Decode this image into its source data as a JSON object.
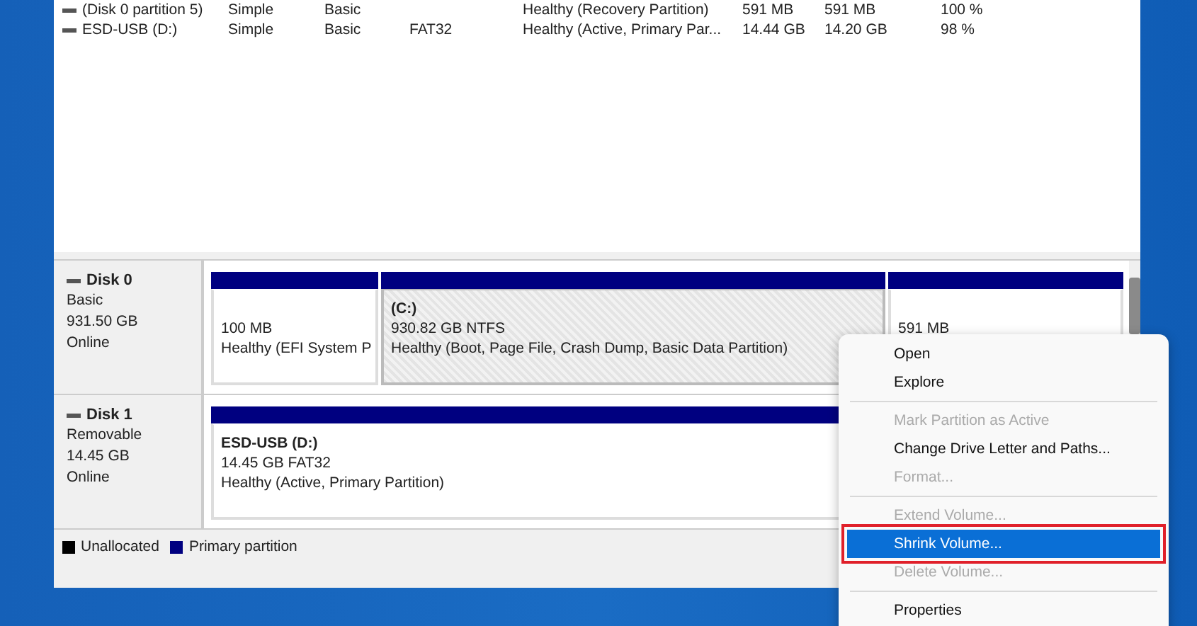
{
  "volume_list": {
    "rows": [
      {
        "name": "(Disk 0 partition 5)",
        "layout": "Simple",
        "type": "Basic",
        "status": "Healthy (Recovery Partition)",
        "capacity": "591 MB",
        "free_space": "591 MB",
        "percent_free": "100 %"
      },
      {
        "name": "ESD-USB (D:)",
        "layout": "Simple",
        "type": "Basic",
        "file_system": "FAT32",
        "status": "Healthy (Active, Primary Par...",
        "capacity": "14.44 GB",
        "free_space": "14.20 GB",
        "percent_free": "98 %"
      }
    ]
  },
  "disks": [
    {
      "name": "Disk 0",
      "type": "Basic",
      "size": "931.50 GB",
      "state": "Online",
      "partitions": [
        {
          "size": "100 MB",
          "status": "Healthy (EFI System P",
          "selected": false
        },
        {
          "label": "(C:)",
          "size": "930.82 GB NTFS",
          "status": "Healthy (Boot, Page File, Crash Dump, Basic Data Partition)",
          "selected": true
        },
        {
          "size": "591 MB",
          "selected": false
        }
      ]
    },
    {
      "name": "Disk 1",
      "type": "Removable",
      "size": "14.45 GB",
      "state": "Online",
      "partitions": [
        {
          "label": "ESD-USB  (D:)",
          "size": "14.45 GB FAT32",
          "status": "Healthy (Active, Primary Partition)",
          "selected": false
        }
      ]
    }
  ],
  "legend": [
    {
      "label": "Unallocated",
      "color": "#000000"
    },
    {
      "label": "Primary partition",
      "color": "#000080"
    }
  ],
  "context_menu": [
    {
      "label": "Open",
      "disabled": false,
      "selected": false
    },
    {
      "label": "Explore",
      "disabled": false,
      "selected": false,
      "separator_after": true
    },
    {
      "label": "Mark Partition as Active",
      "disabled": true,
      "selected": false
    },
    {
      "label": "Change Drive Letter and Paths...",
      "disabled": false,
      "selected": false
    },
    {
      "label": "Format...",
      "disabled": true,
      "selected": false,
      "separator_after": true
    },
    {
      "label": "Extend Volume...",
      "disabled": true,
      "selected": false
    },
    {
      "label": "Shrink Volume...",
      "disabled": false,
      "selected": true
    },
    {
      "label": "Delete Volume...",
      "disabled": true,
      "selected": false,
      "separator_after": true
    },
    {
      "label": "Properties",
      "disabled": false,
      "selected": false
    }
  ]
}
